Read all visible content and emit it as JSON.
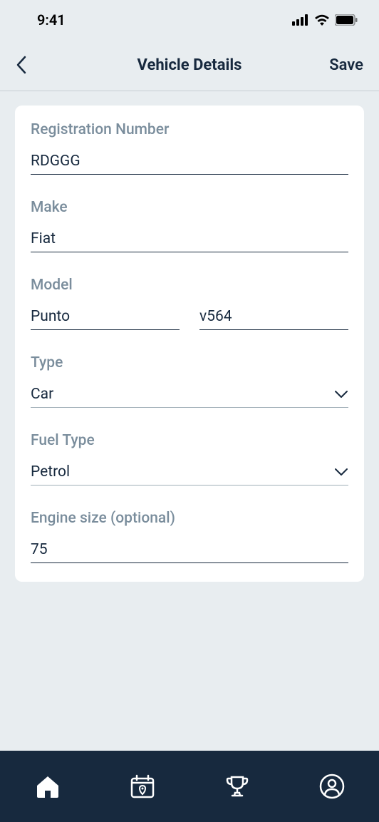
{
  "statusBar": {
    "time": "9:41"
  },
  "header": {
    "title": "Vehicle Details",
    "saveLabel": "Save"
  },
  "form": {
    "registrationNumber": {
      "label": "Registration Number",
      "value": "RDGGG"
    },
    "make": {
      "label": "Make",
      "value": "Fiat"
    },
    "model": {
      "label": "Model",
      "value1": "Punto",
      "value2": "v564"
    },
    "type": {
      "label": "Type",
      "value": "Car"
    },
    "fuelType": {
      "label": "Fuel Type",
      "value": "Petrol"
    },
    "engineSize": {
      "label": "Engine size (optional)",
      "value": "75"
    }
  }
}
